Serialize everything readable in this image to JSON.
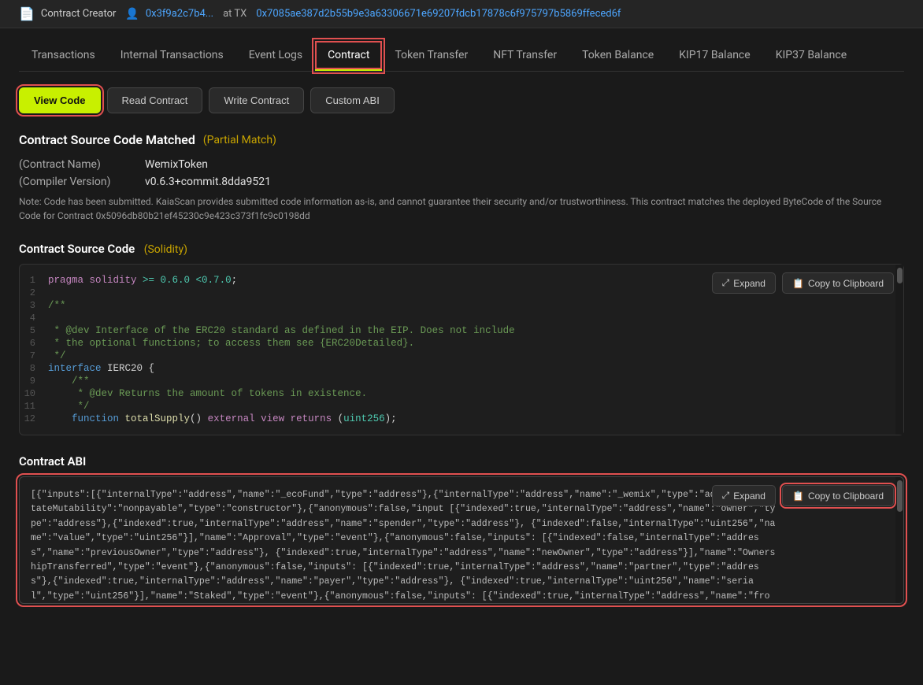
{
  "topbar": {
    "icon": "📄",
    "label": "Contract Creator",
    "address_short": "0x3f9a2c7b4...",
    "at_text": "at TX",
    "tx_hash": "0x7085ae387d2b55b9e3a63306671e69207fdcb17878c6f975797b5869ffeced6f"
  },
  "tabs": [
    {
      "id": "transactions",
      "label": "Transactions",
      "active": false
    },
    {
      "id": "internal-transactions",
      "label": "Internal Transactions",
      "active": false
    },
    {
      "id": "event-logs",
      "label": "Event Logs",
      "active": false
    },
    {
      "id": "contract",
      "label": "Contract",
      "active": true
    },
    {
      "id": "token-transfer",
      "label": "Token Transfer",
      "active": false
    },
    {
      "id": "nft-transfer",
      "label": "NFT Transfer",
      "active": false
    },
    {
      "id": "token-balance",
      "label": "Token Balance",
      "active": false
    },
    {
      "id": "kip17-balance",
      "label": "KIP17 Balance",
      "active": false
    },
    {
      "id": "kip37-balance",
      "label": "KIP37 Balance",
      "active": false
    }
  ],
  "sub_buttons": [
    {
      "id": "view-code",
      "label": "View Code",
      "active": true
    },
    {
      "id": "read-contract",
      "label": "Read Contract",
      "active": false
    },
    {
      "id": "write-contract",
      "label": "Write Contract",
      "active": false
    },
    {
      "id": "custom-abi",
      "label": "Custom ABI",
      "active": false
    }
  ],
  "contract_source": {
    "title": "Contract Source Code Matched",
    "match_type": "(Partial Match)",
    "name_label": "(Contract Name)",
    "name_value": "WemixToken",
    "compiler_label": "(Compiler Version)",
    "compiler_value": "v0.6.3+commit.8dda9521",
    "note": "Note: Code has been submitted. KaiaScan provides submitted code information as-is, and cannot guarantee their security and/or trustworthiness. This contract matches the deployed ByteCode of the Source Code for Contract 0x5096db80b21ef45230c9e423c373f1fc9c0198dd"
  },
  "source_code_section": {
    "title": "Contract Source Code",
    "subtitle": "(Solidity)",
    "expand_label": "Expand",
    "copy_label": "Copy to Clipboard",
    "lines": [
      {
        "num": 1,
        "code": "pragma solidity >= 0.6.0 <0.7.0;"
      },
      {
        "num": 2,
        "code": ""
      },
      {
        "num": 3,
        "code": "/**"
      },
      {
        "num": 4,
        "code": ""
      },
      {
        "num": 5,
        "code": " * @dev Interface of the ERC20 standard as defined in the EIP. Does not include"
      },
      {
        "num": 6,
        "code": " * the optional functions; to access them see {ERC20Detailed}."
      },
      {
        "num": 7,
        "code": " */"
      },
      {
        "num": 8,
        "code": "interface IERC20 {"
      },
      {
        "num": 9,
        "code": "    /**"
      },
      {
        "num": 10,
        "code": "     * @dev Returns the amount of tokens in existence."
      },
      {
        "num": 11,
        "code": "     */"
      },
      {
        "num": 12,
        "code": "    function totalSupply() external view returns (uint256);"
      }
    ]
  },
  "abi_section": {
    "title": "Contract ABI",
    "expand_label": "Expand",
    "copy_label": "Copy to Clipboard",
    "content": "[{\"inputs\":[{\"internalType\":\"address\",\"name\":\"_ecoFund\",\"type\":\"address\"},{\"internalType\":\"address\",\"name\":\"_wemix\",\"type\":\"address\"}],\"stateMutability\":\"nonpayable\",\"type\":\"constructor\"},{\"anonymous\":false,\"input [{\"indexed\":true,\"internalType\":\"address\",\"name\":\"owner\",\"type\":\"address\"},{\"indexed\":true,\"internalType\":\"address\",\"name\":\"spender\",\"type\":\"address\"}, {\"indexed\":false,\"internalType\":\"uint256\",\"name\":\"value\",\"type\":\"uint256\"}],\"name\":\"Approval\",\"type\":\"event\"},{\"anonymous\":false,\"inputs\": [{\"indexed\":false,\"internalType\":\"address\",\"name\":\"previousOwner\",\"type\":\"address\"}, {\"indexed\":true,\"internalType\":\"address\",\"name\":\"newOwner\",\"type\":\"address\"}],\"name\":\"OwnershipTransferred\",\"type\":\"event\"},{\"anonymous\":false,\"inputs\": [{\"indexed\":true,\"internalType\":\"address\",\"name\":\"partner\",\"type\":\"address\"},{\"indexed\":true,\"internalType\":\"address\",\"name\":\"payer\",\"type\":\"address\"}, {\"indexed\":true,\"internalType\":\"uint256\",\"name\":\"serial\",\"type\":\"uint256\"}],\"name\":\"Staked\",\"type\":\"event\"},{\"anonymous\":false,\"inputs\": [{\"indexed\":true,\"internalType\":\"address\",\"name\":\"from\",\"type\":\"address\"},{\"indexed\":true,\"internalType\":\"address\",\"name\":\"to\",\"type\":\"address\"},"
  }
}
